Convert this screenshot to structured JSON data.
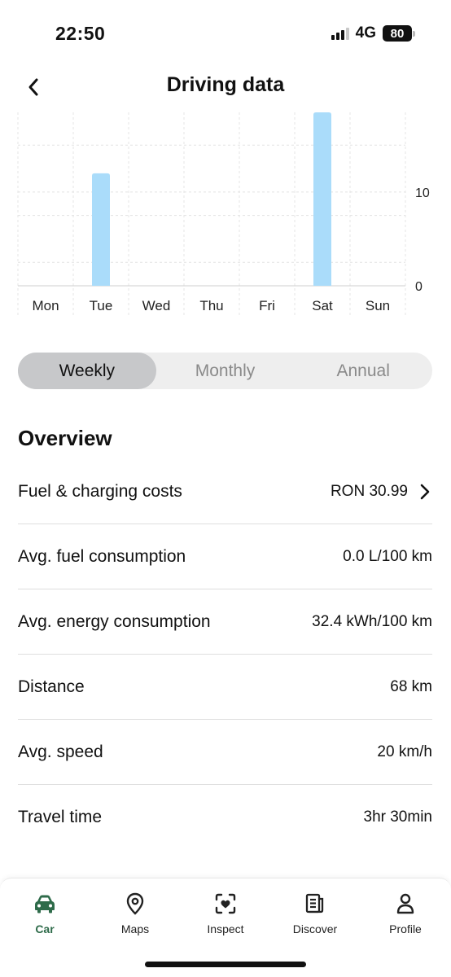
{
  "status_bar": {
    "time": "22:50",
    "network": "4G",
    "battery": "80"
  },
  "header": {
    "title": "Driving data",
    "back_icon": "chevron-left-icon"
  },
  "chart_data": {
    "type": "bar",
    "categories": [
      "Mon",
      "Tue",
      "Wed",
      "Thu",
      "Fri",
      "Sat",
      "Sun"
    ],
    "values": [
      0,
      12,
      0,
      0,
      0,
      18.5,
      0
    ],
    "yticks": [
      "0",
      "10"
    ],
    "ylim": [
      0,
      18.5
    ],
    "grid": true,
    "bar_color": "#aadcfa"
  },
  "period_tabs": [
    "Weekly",
    "Monthly",
    "Annual"
  ],
  "active_tab": "Weekly",
  "overview": {
    "title": "Overview",
    "rows": [
      {
        "label": "Fuel & charging costs",
        "value": "RON 30.99",
        "has_chevron": true
      },
      {
        "label": "Avg. fuel consumption",
        "value": "0.0 L/100 km"
      },
      {
        "label": "Avg. energy consumption",
        "value": "32.4 kWh/100 km"
      },
      {
        "label": "Distance",
        "value": "68 km"
      },
      {
        "label": "Avg. speed",
        "value": "20 km/h"
      },
      {
        "label": "Travel time",
        "value": "3hr 30min"
      }
    ]
  },
  "nav": {
    "items": [
      {
        "label": "Car",
        "icon": "car-icon",
        "active": true
      },
      {
        "label": "Maps",
        "icon": "map-pin-icon"
      },
      {
        "label": "Inspect",
        "icon": "inspect-icon"
      },
      {
        "label": "Discover",
        "icon": "news-icon"
      },
      {
        "label": "Profile",
        "icon": "profile-icon"
      }
    ]
  },
  "colors": {
    "accent": "#2e6b4a",
    "bar": "#aadcfa",
    "tab_active_bg": "#c7c8ca"
  }
}
